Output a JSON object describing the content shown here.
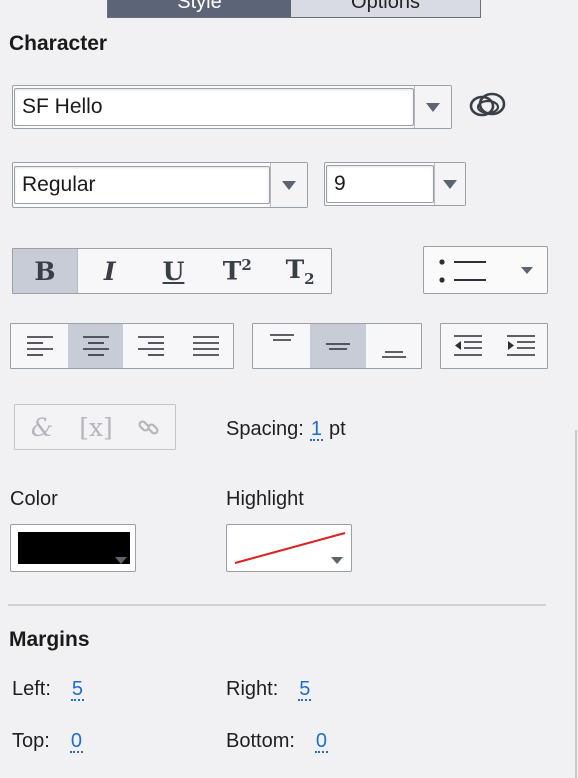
{
  "tabs": {
    "active_label": "Style",
    "inactive_label": "Options"
  },
  "character": {
    "title": "Character",
    "font_family": "SF Hello",
    "font_style": "Regular",
    "font_size": "9",
    "style_buttons": [
      {
        "label": "B",
        "active": true
      },
      {
        "label": "I",
        "active": false
      },
      {
        "label": "U",
        "active": false
      },
      {
        "label": "T²",
        "active": false
      },
      {
        "label": "T₂",
        "active": false
      }
    ],
    "alignment_selected": "center",
    "vertical_alignment_selected": "middle",
    "spacing_label": "Spacing:",
    "spacing_value": "1",
    "spacing_unit": "pt",
    "color_label": "Color",
    "color_value": "#000000",
    "highlight_label": "Highlight",
    "highlight_value": "none"
  },
  "margins": {
    "title": "Margins",
    "left_label": "Left:",
    "left_value": "5",
    "right_label": "Right:",
    "right_value": "5",
    "top_label": "Top:",
    "top_value": "0",
    "bottom_label": "Bottom:",
    "bottom_value": "0"
  },
  "colors": {
    "accent": "#1c6fd1",
    "segment_active": "#c7ccd6",
    "tab_active": "#5c6577",
    "highlight_line": "#e02020"
  }
}
